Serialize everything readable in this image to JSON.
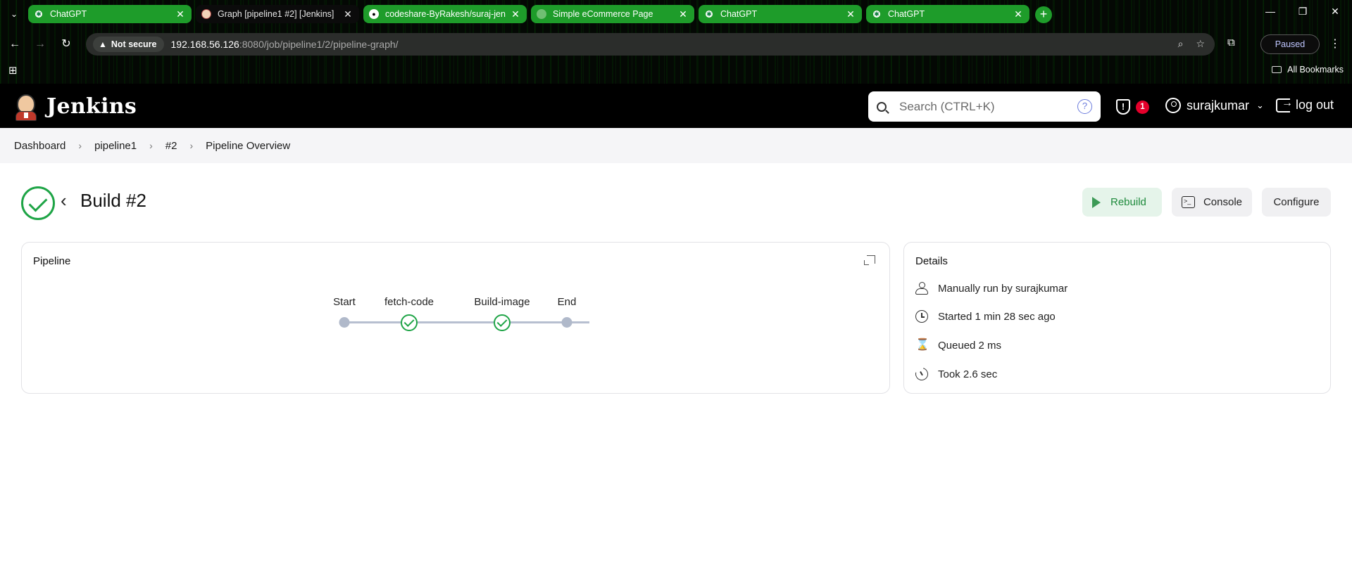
{
  "browser": {
    "tabs": [
      {
        "title": "ChatGPT",
        "icon": "chatgpt-icon"
      },
      {
        "title": "Graph [pipeline1 #2] [Jenkins]",
        "icon": "jenkins-icon"
      },
      {
        "title": "codeshare-ByRakesh/suraj-jenk",
        "icon": "github-icon"
      },
      {
        "title": "Simple eCommerce Page",
        "icon": "globe-icon"
      },
      {
        "title": "ChatGPT",
        "icon": "chatgpt-icon"
      },
      {
        "title": "ChatGPT",
        "icon": "chatgpt-icon"
      }
    ],
    "not_secure_label": "Not secure",
    "url_host": "192.168.56.126",
    "url_path": ":8080/job/pipeline1/2/pipeline-graph/",
    "profile_status": "Paused",
    "all_bookmarks_label": "All Bookmarks",
    "tab_accent_color": "#1e9c2a"
  },
  "jenkins": {
    "logo_text": "Jenkins",
    "search_placeholder": "Search (CTRL+K)",
    "help_glyph": "?",
    "security_badge_count": "1",
    "username": "surajkumar",
    "logout_label": "log out"
  },
  "breadcrumb": {
    "items": [
      "Dashboard",
      "pipeline1",
      "#2",
      "Pipeline Overview"
    ],
    "separator": "›"
  },
  "build": {
    "title": "Build #2",
    "status": "success",
    "status_color": "#1ea446",
    "actions": {
      "rebuild": "Rebuild",
      "console": "Console",
      "configure": "Configure"
    }
  },
  "pipeline": {
    "title": "Pipeline",
    "stages": [
      {
        "name": "Start",
        "state": "marker"
      },
      {
        "name": "fetch-code",
        "state": "success"
      },
      {
        "name": "Build-image",
        "state": "success"
      },
      {
        "name": "End",
        "state": "marker"
      }
    ]
  },
  "details": {
    "title": "Details",
    "rows": [
      {
        "icon": "user-icon",
        "text": "Manually run by surajkumar"
      },
      {
        "icon": "clock-icon",
        "text": "Started 1 min 28 sec ago"
      },
      {
        "icon": "hourglass-icon",
        "text": "Queued 2 ms"
      },
      {
        "icon": "timer-icon",
        "text": "Took 2.6 sec"
      }
    ]
  }
}
